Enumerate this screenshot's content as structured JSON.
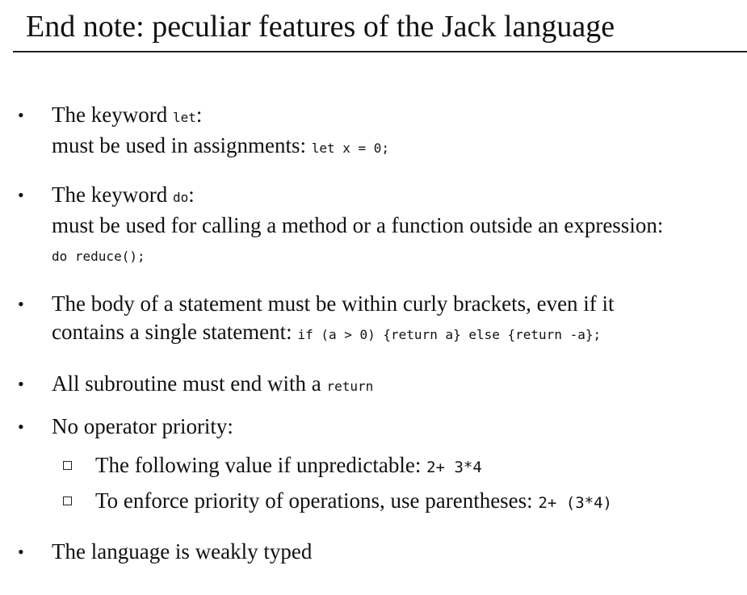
{
  "slide": {
    "title": "End note: peculiar features of the Jack language"
  },
  "bullets": [
    {
      "marker": "•",
      "line1_text": "The keyword ",
      "line1_code": "let",
      "line1_suffix": ":",
      "line2_text": "must be used in assignments: ",
      "line2_code": "let x = 0;"
    },
    {
      "marker": "•",
      "line1_text": "The keyword ",
      "line1_code": "do",
      "line1_suffix": ":",
      "line2_text": "must be used for calling a method or a function outside an expression:",
      "line3_code": "do reduce();"
    },
    {
      "marker": "•",
      "line1_text": "The body of a statement must be within curly brackets, even if it",
      "line2_text": "contains a single statement: ",
      "line2_code": "if (a > 0) {return a} else {return -a};"
    },
    {
      "marker": "•",
      "line1_text": "All subroutine must end with a ",
      "line1_code": "return"
    },
    {
      "marker": "•",
      "line1_text": "No operator priority:",
      "subitems": [
        {
          "text": "The following value if unpredictable:  ",
          "code": "2+ 3*4"
        },
        {
          "text": "To enforce priority of operations, use parentheses:  ",
          "code": "2+ (3*4)"
        }
      ]
    },
    {
      "marker": "•",
      "line1_text": "The language is weakly typed"
    }
  ]
}
